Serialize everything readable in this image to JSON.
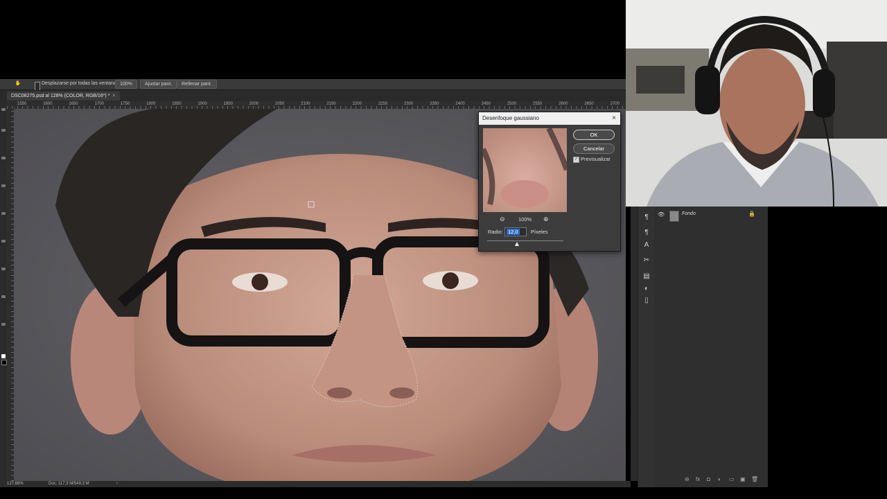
{
  "options_bar": {
    "scroll_all_windows_label": "Desplazarse por todas las ventanas",
    "zoom_100_button": "100%",
    "fit_screen_button": "Ajustar pant.",
    "fill_screen_button": "Rellenar pant."
  },
  "document": {
    "tab_label": "DSC08275.psd al 128% (COLOR, RGB/16*) *",
    "close_glyph": "×"
  },
  "ruler": {
    "ticks": [
      "1550",
      "1600",
      "1650",
      "1700",
      "1750",
      "1800",
      "1850",
      "1900",
      "1950",
      "2000",
      "2050",
      "2100",
      "2150",
      "2200",
      "2250",
      "2300",
      "2350",
      "2400",
      "2450",
      "2500",
      "2550",
      "2600",
      "2650",
      "2700"
    ]
  },
  "status_bar": {
    "zoom": "127,68%",
    "doc_info": "Doc: 117,3 M/549,3 M",
    "arrow": "›"
  },
  "dialog": {
    "title": "Desenfoque gaussiano",
    "close_glyph": "×",
    "ok_label": "OK",
    "cancel_label": "Cancelar",
    "preview_label": "Previsualizar",
    "preview_checked": true,
    "preview_check_glyph": "✓",
    "zoom_out_glyph": "⊖",
    "zoom_in_glyph": "⊕",
    "zoom_level": "100%",
    "radius_label": "Radio:",
    "radius_value": "12,0",
    "radius_unit": "Píxeles"
  },
  "layers": {
    "eye_glyph": "👁",
    "layer_name": "Fondo",
    "lock_glyph": "🔒",
    "footer_icons": [
      "⊖",
      "fx",
      "◘",
      "◐",
      "▭",
      "▣",
      "🗑"
    ]
  },
  "panel_icons": [
    "¶",
    "¶",
    "A",
    "✂",
    "▤",
    "◐",
    "▯"
  ],
  "colors": {
    "ui_dark": "#2b2b2b",
    "dialog_bg": "#3c3c3c",
    "selection_blue": "#2f6fcf"
  }
}
